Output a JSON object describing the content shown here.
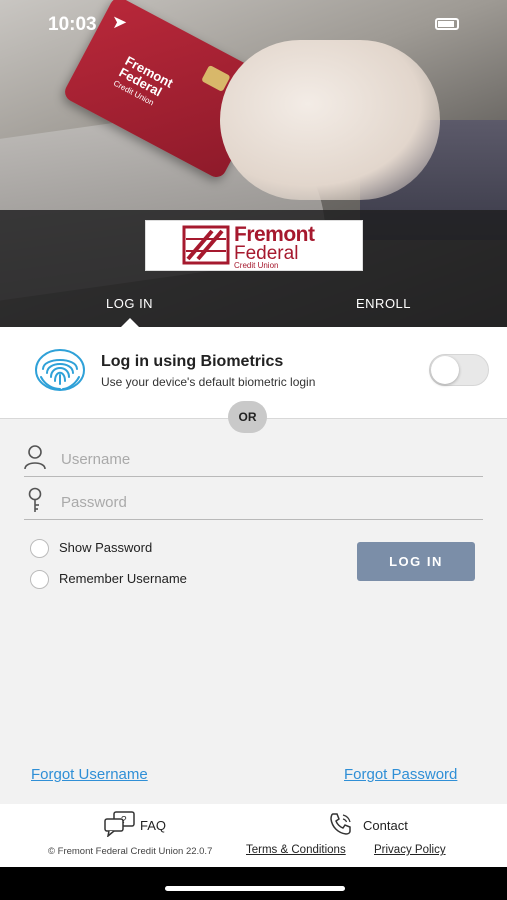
{
  "status_bar": {
    "time": "10:03",
    "location_glyph": "➤"
  },
  "brand": {
    "name_line1": "Fremont",
    "name_line2": "Federal",
    "name_line3": "Credit Union",
    "card_line1": "Fremont",
    "card_line2": "Federal",
    "card_line3": "Credit Union",
    "color": "#a6192e"
  },
  "tabs": [
    {
      "label": "LOG IN",
      "active": true
    },
    {
      "label": "ENROLL",
      "active": false
    }
  ],
  "biometrics": {
    "title": "Log in using Biometrics",
    "subtitle": "Use your device's default biometric login",
    "enabled": false,
    "icon": "fingerprint-icon"
  },
  "divider": {
    "label": "OR"
  },
  "form": {
    "username_placeholder": "Username",
    "password_placeholder": "Password",
    "username_value": "",
    "password_value": "",
    "show_password_label": "Show Password",
    "remember_username_label": "Remember Username",
    "login_button_label": "LOG IN"
  },
  "links": {
    "forgot_username": "Forgot Username",
    "forgot_password": "Forgot Password",
    "color": "#2f8fd6"
  },
  "footer": {
    "faq_label": "FAQ",
    "contact_label": "Contact",
    "copyright": "© Fremont Federal Credit Union 22.0.7",
    "terms_label": "Terms & Conditions",
    "privacy_label": "Privacy Policy"
  },
  "colors": {
    "login_button": "#7b8ea8",
    "form_background": "#f2f2f2"
  }
}
